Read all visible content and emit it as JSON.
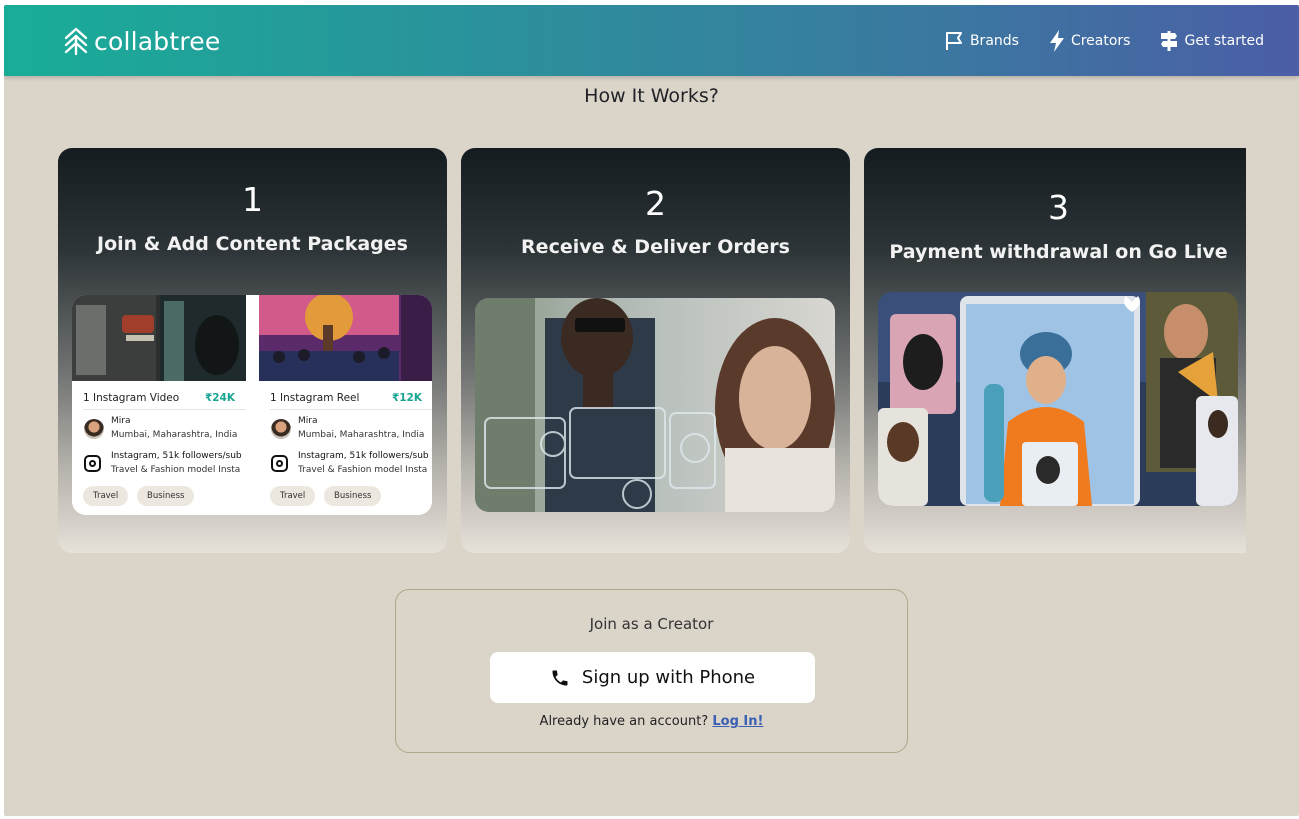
{
  "brand": {
    "name": "collabtree"
  },
  "nav": {
    "items": [
      {
        "label": "Brands",
        "icon": "flag-icon"
      },
      {
        "label": "Creators",
        "icon": "bolt-icon"
      },
      {
        "label": "Get started",
        "icon": "signpost-icon"
      }
    ]
  },
  "section": {
    "title": "How It Works?"
  },
  "steps": [
    {
      "number": "1",
      "title": "Join & Add Content Packages",
      "packages": [
        {
          "title": "1 Instagram Video",
          "price": "₹24K",
          "creator_name": "Mira",
          "location": "Mumbai, Maharashtra, India",
          "stats": "Instagram, 51k followers/sub",
          "description": "Travel & Fashion model Insta",
          "tags": [
            "Travel",
            "Business"
          ]
        },
        {
          "title": "1 Instagram Reel",
          "price": "₹12K",
          "creator_name": "Mira",
          "location": "Mumbai, Maharashtra, India",
          "stats": "Instagram, 51k followers/sub",
          "description": "Travel & Fashion model Insta",
          "tags": [
            "Travel",
            "Business"
          ]
        }
      ]
    },
    {
      "number": "2",
      "title": "Receive & Deliver Orders"
    },
    {
      "number": "3",
      "title": "Payment withdrawal on Go Live"
    }
  ],
  "join": {
    "title": "Join as a Creator",
    "phone_button": "Sign up with Phone",
    "login_prompt": "Already have an account?",
    "login_link": "Log In!"
  },
  "colors": {
    "header_start": "#19ad98",
    "header_end": "#4b5ea6",
    "background": "#dbd4c9",
    "accent_price": "#1aa592",
    "link": "#3a5fb3"
  }
}
